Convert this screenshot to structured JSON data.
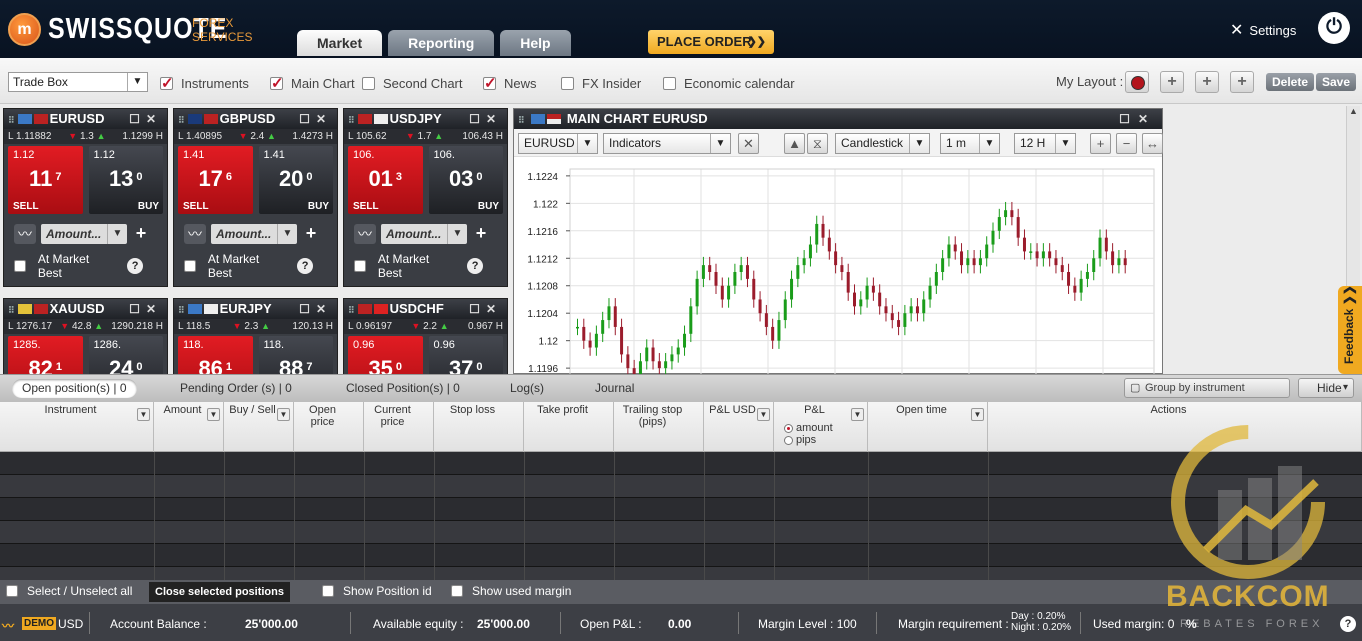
{
  "brand": {
    "name": "SWISSQUOTE",
    "sub1": "FOREX",
    "sub2": "SERVICES",
    "logo_letter": "m"
  },
  "nav": {
    "tabs": [
      {
        "label": "Market"
      },
      {
        "label": "Reporting"
      },
      {
        "label": "Help"
      }
    ],
    "place_order": "PLACE ORDER",
    "settings": "Settings"
  },
  "toolbar": {
    "tradebox": "Trade Box",
    "checks": [
      {
        "label": "Instruments",
        "checked": true
      },
      {
        "label": "Main Chart",
        "checked": true
      },
      {
        "label": "Second Chart",
        "checked": false
      },
      {
        "label": "News",
        "checked": true
      },
      {
        "label": "FX Insider",
        "checked": false
      },
      {
        "label": "Economic calendar",
        "checked": false
      }
    ],
    "my_layout": "My Layout :",
    "delete": "Delete",
    "save": "Save"
  },
  "tiles": [
    {
      "pair": "EURUSD",
      "low": "L 1.11882",
      "change": "1.3",
      "high": "1.1299 H",
      "sell_small": "1.12",
      "sell_big": "11",
      "sell_sup": "7",
      "buy_small": "1.12",
      "buy_big": "13",
      "buy_sup": "0"
    },
    {
      "pair": "GBPUSD",
      "low": "L 1.40895",
      "change": "2.4",
      "high": "1.4273 H",
      "sell_small": "1.41",
      "sell_big": "17",
      "sell_sup": "6",
      "buy_small": "1.41",
      "buy_big": "20",
      "buy_sup": "0"
    },
    {
      "pair": "USDJPY",
      "low": "L 105.62",
      "change": "1.7",
      "high": "106.43 H",
      "sell_small": "106.",
      "sell_big": "01",
      "sell_sup": "3",
      "buy_small": "106.",
      "buy_big": "03",
      "buy_sup": "0"
    },
    {
      "pair": "XAUUSD",
      "low": "L 1276.17",
      "change": "42.8",
      "high": "1290.218 H",
      "sell_small": "1285.",
      "sell_big": "82",
      "sell_sup": "1",
      "buy_small": "1286.",
      "buy_big": "24",
      "buy_sup": "0"
    },
    {
      "pair": "EURJPY",
      "low": "L 118.5",
      "change": "2.3",
      "high": "120.13 H",
      "sell_small": "118.",
      "sell_big": "86",
      "sell_sup": "1",
      "buy_small": "118.",
      "buy_big": "88",
      "buy_sup": "7"
    },
    {
      "pair": "USDCHF",
      "low": "L 0.96197",
      "change": "2.2",
      "high": "0.967 H",
      "sell_small": "0.96",
      "sell_big": "35",
      "sell_sup": "0",
      "buy_small": "0.96",
      "buy_big": "37",
      "buy_sup": "0"
    }
  ],
  "tile_labels": {
    "sell": "SELL",
    "buy": "BUY",
    "amount": "Amount...",
    "market_best": "At Market Best",
    "help": "?"
  },
  "main_chart": {
    "title": "MAIN CHART EURUSD",
    "symbol": "EURUSD",
    "indicators": "Indicators",
    "chart_type": "Candlestick",
    "interval": "1 m",
    "range": "12 H"
  },
  "chart_data": {
    "type": "candlestick",
    "y_ticks": [
      "1.1224",
      "1.122",
      "1.1216",
      "1.1212",
      "1.1208",
      "1.1204",
      "1.12",
      "1.1196"
    ],
    "ylim": [
      1.1195,
      1.1225
    ],
    "grid": true,
    "up_color": "#1a9c1a",
    "down_color": "#9b1c2c",
    "series": [
      1.1202,
      1.12,
      1.1199,
      1.1201,
      1.1203,
      1.1205,
      1.1202,
      1.1198,
      1.1196,
      1.1195,
      1.1197,
      1.1199,
      1.1197,
      1.1196,
      1.1197,
      1.1198,
      1.1199,
      1.1201,
      1.1205,
      1.1209,
      1.1211,
      1.121,
      1.1208,
      1.1206,
      1.1208,
      1.121,
      1.1211,
      1.1209,
      1.1206,
      1.1204,
      1.1202,
      1.12,
      1.1203,
      1.1206,
      1.1209,
      1.1211,
      1.1212,
      1.1214,
      1.1217,
      1.1215,
      1.1213,
      1.1211,
      1.121,
      1.1207,
      1.1205,
      1.1206,
      1.1208,
      1.1207,
      1.1205,
      1.1204,
      1.1203,
      1.1202,
      1.1204,
      1.1205,
      1.1204,
      1.1206,
      1.1208,
      1.121,
      1.1212,
      1.1214,
      1.1213,
      1.1211,
      1.1212,
      1.1211,
      1.1212,
      1.1214,
      1.1216,
      1.1218,
      1.1219,
      1.1218,
      1.1215,
      1.1213,
      1.1213,
      1.1212,
      1.1213,
      1.1212,
      1.1211,
      1.121,
      1.1208,
      1.1207,
      1.1209,
      1.121,
      1.1212,
      1.1215,
      1.1213,
      1.1211,
      1.1212,
      1.1211
    ]
  },
  "positions": {
    "tabs": [
      "Open position(s) |  0",
      "Pending Order (s) |  0",
      "Closed Position(s) | 0",
      "Log(s)",
      "Journal"
    ],
    "group_by": "Group by instrument",
    "hide": "Hide",
    "columns": [
      {
        "label": "Instrument",
        "sort": true
      },
      {
        "label": "Amount",
        "sort": true
      },
      {
        "label": "Buy / Sell",
        "sort": true
      },
      {
        "label": "Open price",
        "sort": false
      },
      {
        "label": "Current price",
        "sort": false
      },
      {
        "label": "Stop loss",
        "sort": false
      },
      {
        "label": "Take profit",
        "sort": false
      },
      {
        "label": "Trailing stop (pips)",
        "sort": false
      },
      {
        "label": "P&L USD",
        "sort": true
      },
      {
        "label": "P&L",
        "sort": true
      },
      {
        "label": "Open time",
        "sort": true
      },
      {
        "label": "Actions",
        "sort": false
      }
    ],
    "pl_options": [
      "amount",
      "pips"
    ],
    "select_all": "Select / Unselect all",
    "close_selected": "Close selected positions",
    "show_id": "Show Position id",
    "show_margin": "Show used margin"
  },
  "status": {
    "demo": "DEMO",
    "currency": "USD",
    "balance_label": "Account Balance :",
    "balance": "25'000.00",
    "equity_label": "Available equity :",
    "equity": "25'000.00",
    "pl_label": "Open P&L :",
    "pl": "0.00",
    "margin_level": "Margin Level : 100",
    "margin_req_label": "Margin requirement :",
    "margin_day": "Day : 0.20%",
    "margin_night": "Night : 0.20%",
    "used_margin": "Used margin: 0",
    "percent": "%",
    "help": "?"
  },
  "watermark": {
    "line1": "BACKCOM",
    "line2": "REBATES FOREX"
  }
}
